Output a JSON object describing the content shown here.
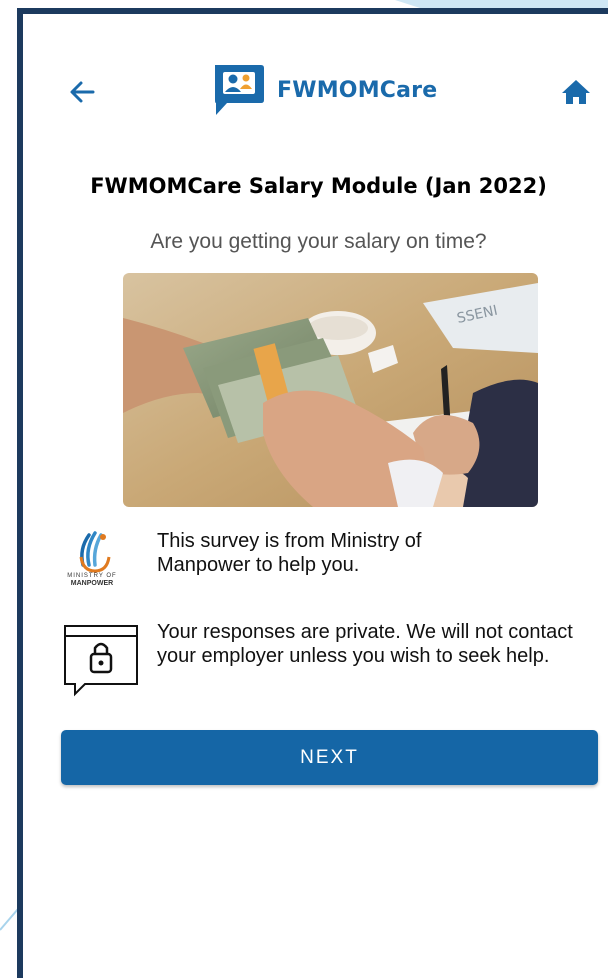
{
  "app": {
    "name": "FWMOMCare",
    "accent_color": "#1a6aab"
  },
  "header": {
    "back_icon": "arrow-left-icon",
    "home_icon": "home-icon",
    "logo_icon": "chat-worker-logo-icon"
  },
  "page": {
    "title": "FWMOMCare Salary Module (Jan 2022)",
    "question": "Are you getting your salary on time?"
  },
  "info": {
    "ministry_logo_top": "MINISTRY OF",
    "ministry_logo_bottom": "MANPOWER",
    "ministry_text": "This survey is from Ministry of Manpower to help you.",
    "privacy_text": "Your responses are private. We will not contact your employer unless you wish to seek help.",
    "privacy_icon": "lock-chat-icon"
  },
  "actions": {
    "next_label": "NEXT",
    "button_color": "#1566a6"
  }
}
